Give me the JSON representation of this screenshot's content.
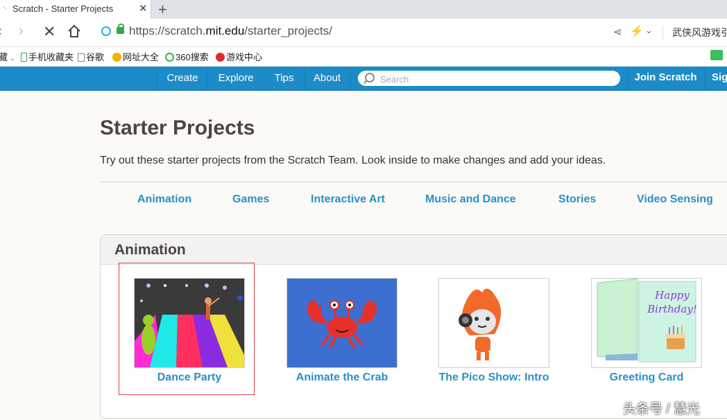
{
  "browser": {
    "tab_title": "Scratch - Starter Projects",
    "url_scheme": "https://scratch.",
    "url_host": "mit.edu",
    "url_path": "/starter_projects/",
    "search_suggest": "武侠风游戏引",
    "bookmarks": [
      {
        "label": "藏",
        "icon": "bookmark-chevron-icon"
      },
      {
        "label": "手机收藏夹",
        "icon": "phone-icon"
      },
      {
        "label": "谷歌",
        "icon": "page-icon"
      },
      {
        "label": "网址大全",
        "icon": "web-icon"
      },
      {
        "label": "360搜索",
        "icon": "360-icon"
      },
      {
        "label": "游戏中心",
        "icon": "game-icon"
      }
    ]
  },
  "nav": {
    "items": [
      {
        "label": "Create"
      },
      {
        "label": "Explore"
      },
      {
        "label": "Tips"
      },
      {
        "label": "About"
      }
    ],
    "search_placeholder": "Search",
    "join_label": "Join Scratch",
    "signin_label": "Sig"
  },
  "page": {
    "title": "Starter Projects",
    "intro": "Try out these starter projects from the Scratch Team. Look inside to make changes and add your ideas.",
    "categories": [
      {
        "label": "Animation"
      },
      {
        "label": "Games"
      },
      {
        "label": "Interactive Art"
      },
      {
        "label": "Music and Dance"
      },
      {
        "label": "Stories"
      },
      {
        "label": "Video Sensing"
      }
    ],
    "section": {
      "title": "Animation",
      "projects": [
        {
          "title": "Dance Party"
        },
        {
          "title": "Animate the Crab"
        },
        {
          "title": "The Pico Show: Intro"
        },
        {
          "title": "Greeting Card",
          "card_text": "Happy Birthday!"
        }
      ]
    }
  },
  "watermark": "头条号 / 慧光",
  "colors": {
    "nav_blue": "#1d8bc7",
    "link_blue": "#2990c8",
    "title_brown": "#4d4340"
  }
}
